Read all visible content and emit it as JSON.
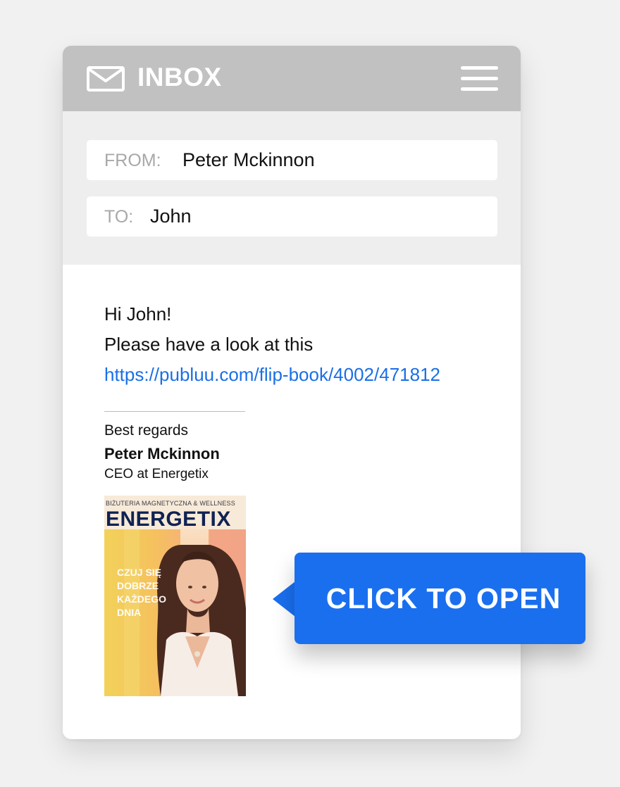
{
  "header": {
    "title": "INBOX",
    "icon": "mail-icon",
    "menu_icon": "hamburger-menu-icon"
  },
  "email": {
    "from_label": "FROM:",
    "from_value": "Peter Mckinnon",
    "to_label": "TO:",
    "to_value": "John",
    "greeting": "Hi John!",
    "message": "Please have a look at this",
    "link": "https://publuu.com/flip-book/4002/471812"
  },
  "signature": {
    "regards": "Best regards",
    "name": "Peter Mckinnon",
    "title": "CEO at Energetix"
  },
  "cover": {
    "kicker": "BIŻUTERIA MAGNETYCZNA & WELLNESS",
    "brand": "ENERGETIX",
    "tagline_1": "CZUJ SIĘ",
    "tagline_2": "DOBRZE",
    "tagline_3": "KAŻDEGO",
    "tagline_4": "DNIA"
  },
  "cta": {
    "label": "CLICK TO OPEN"
  },
  "colors": {
    "accent": "#1a6fef",
    "link": "#1a6fe6",
    "header": "#c1c1c1"
  }
}
